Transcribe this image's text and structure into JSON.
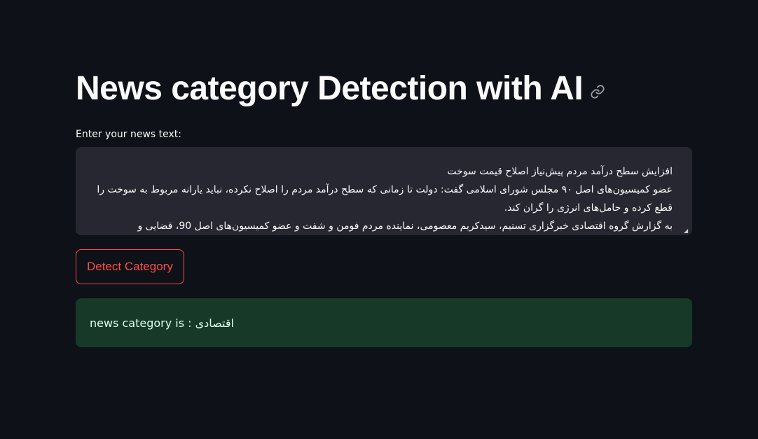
{
  "header": {
    "title": "News category Detection with AI",
    "link_icon": "link-icon"
  },
  "input": {
    "label": "Enter your news text:",
    "value": "افزایش سطح درآمد مردم پیش‌نیاز اصلاح قیمت سوخت\nعضو کمیسیون‌های اصل ۹۰ مجلس شورای اسلامی گفت: دولت تا زمانی که سطح درآمد مردم را اصلاح نکرده، نباید یارانه مربوط به سوخت را قطع کرده و حامل‌های انرژی را گران کند.\nبه گزارش گروه اقتصادی خبرگزاری تسنیم، سیدکریم معصومی، نماینده مردم فومن و شفت و عضو کمیسیون‌های اصل 90، قضایی و"
  },
  "actions": {
    "detect_label": "Detect Category"
  },
  "result": {
    "text": "news category is : اقتصادی"
  },
  "colors": {
    "background": "#0e1117",
    "textarea_bg": "#262730",
    "accent": "#ff4b4b",
    "success_bg": "#173928",
    "success_text": "#dffde9"
  }
}
